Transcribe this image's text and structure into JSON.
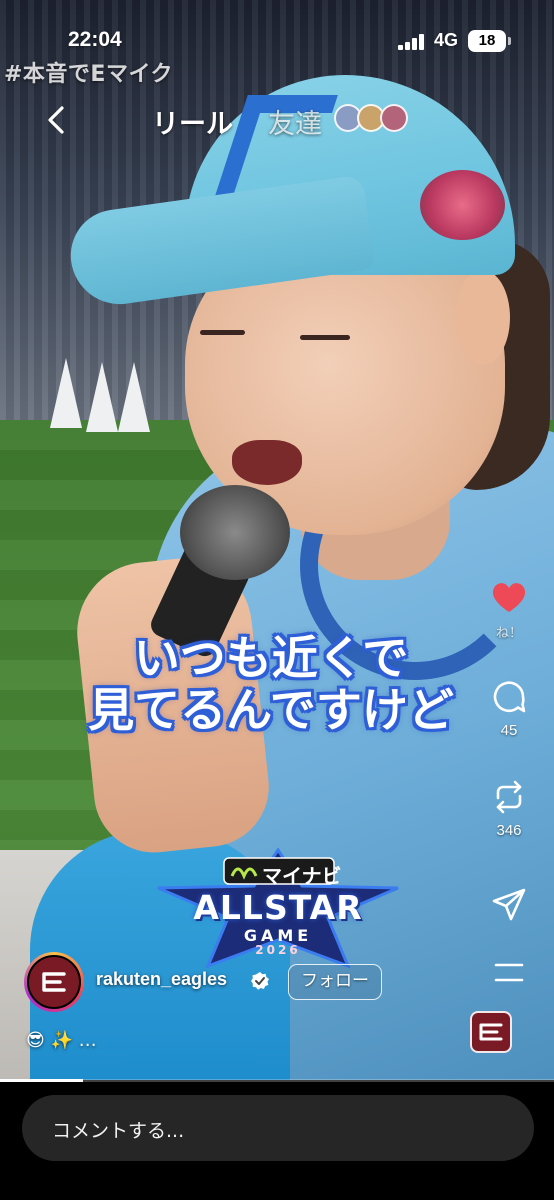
{
  "status_bar": {
    "time": "22:04",
    "network": "4G",
    "battery": "18"
  },
  "overlay": {
    "hashtag": "#本音でEマイク"
  },
  "nav": {
    "back_icon": "chevron-left-icon",
    "tab_reels": "リール",
    "tab_friends": "友達"
  },
  "video": {
    "caption_line1": "いつも近くで",
    "caption_line2": "見てるんですけど",
    "event_logo": {
      "sponsor": "マイナビ",
      "title": "ALLSTAR",
      "subtitle": "GAME",
      "year": "2026"
    },
    "progress": 0.15
  },
  "actions": {
    "like_label": "ね！",
    "comment_count": "45",
    "repost_count": "346",
    "like_color": "#ed4956"
  },
  "account": {
    "username": "rakuten_eagles",
    "follow_label": "フォロー",
    "caption": "😎 ✨ …",
    "brand_color": "#7a1a24"
  },
  "comment": {
    "placeholder": "コメントする..."
  }
}
